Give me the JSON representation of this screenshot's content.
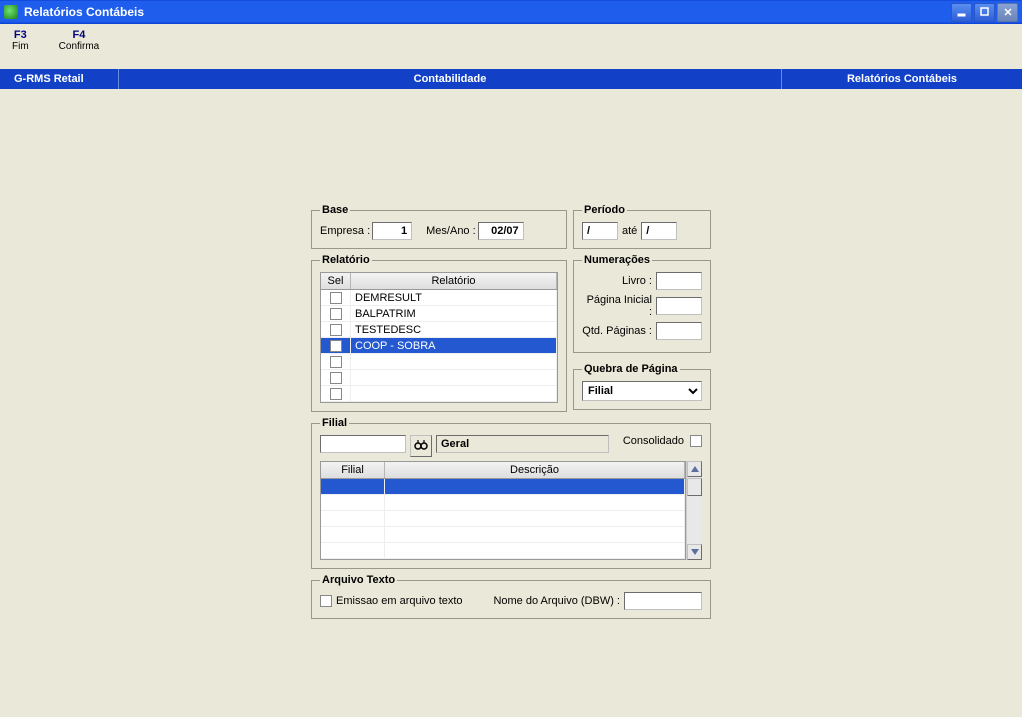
{
  "window": {
    "title": "Relatórios Contábeis"
  },
  "menu": {
    "fim": {
      "key": "F3",
      "label": "Fim"
    },
    "confirma": {
      "key": "F4",
      "label": "Confirma"
    }
  },
  "ribbon": {
    "left": "G-RMS Retail",
    "mid": "Contabilidade",
    "right": "Relatórios Contábeis"
  },
  "base": {
    "legend": "Base",
    "empresa_label": "Empresa :",
    "empresa_value": "1",
    "mesano_label": "Mes/Ano :",
    "mesano_value": "02/07"
  },
  "periodo": {
    "legend": "Período",
    "de": "/",
    "ate_label": "até",
    "ate": "/"
  },
  "relatorio": {
    "legend": "Relatório",
    "col_sel": "Sel",
    "col_name": "Relatório",
    "rows": [
      {
        "name": "DEMRESULT",
        "selected": false
      },
      {
        "name": "BALPATRIM",
        "selected": false
      },
      {
        "name": "TESTEDESC",
        "selected": false
      },
      {
        "name": "COOP - SOBRA",
        "selected": true
      },
      {
        "name": "",
        "selected": false
      },
      {
        "name": "",
        "selected": false
      },
      {
        "name": "",
        "selected": false
      }
    ]
  },
  "numeracoes": {
    "legend": "Numerações",
    "livro_label": "Livro :",
    "pagina_inicial_label": "Página Inicial :",
    "qtd_paginas_label": "Qtd. Páginas :"
  },
  "quebra": {
    "legend": "Quebra de Página",
    "selected": "Filial"
  },
  "filial": {
    "legend": "Filial",
    "geral": "Geral",
    "consolidado_label": "Consolidado",
    "col_filial": "Filial",
    "col_descricao": "Descrição"
  },
  "arquivo": {
    "legend": "Arquivo Texto",
    "emissao_label": "Emissao em arquivo texto",
    "nome_label": "Nome do Arquivo (DBW) :"
  }
}
